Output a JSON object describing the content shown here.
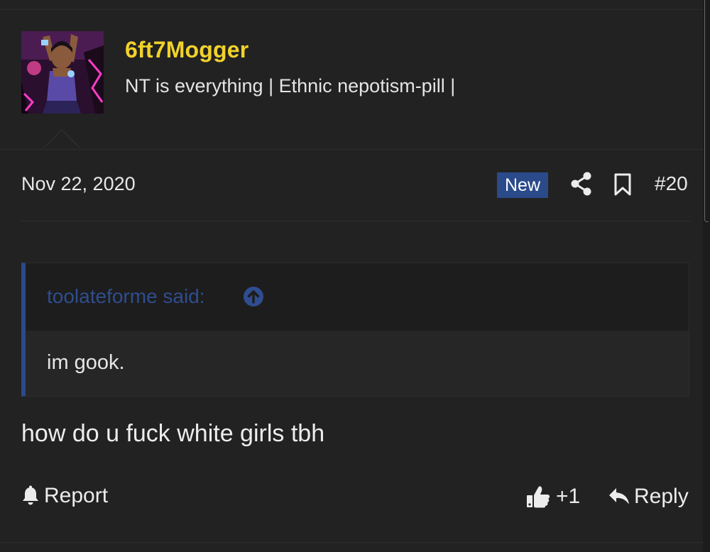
{
  "user": {
    "name": "6ft7Mogger",
    "title": "NT is everything | Ethnic nepotism-pill |"
  },
  "post": {
    "date": "Nov 22, 2020",
    "badge": "New",
    "number": "#20",
    "message": "how do u fuck white girls tbh"
  },
  "quote": {
    "author": "toolateforme said:",
    "body": "im gook."
  },
  "actions": {
    "report_label": "Report",
    "reaction_count": "+1",
    "reply_label": "Reply"
  },
  "icons": {
    "share": "share-icon",
    "bookmark": "bookmark-icon",
    "quote_jump": "arrow-up-circle-icon",
    "report": "bell-icon",
    "like": "thumbs-up-icon",
    "reply": "reply-arrow-icon"
  },
  "colors": {
    "background": "#222222",
    "username": "#f1d22a",
    "accent_blue": "#2a4a8a",
    "quote_author": "#2f4d8f",
    "text": "#e6e6e6"
  }
}
